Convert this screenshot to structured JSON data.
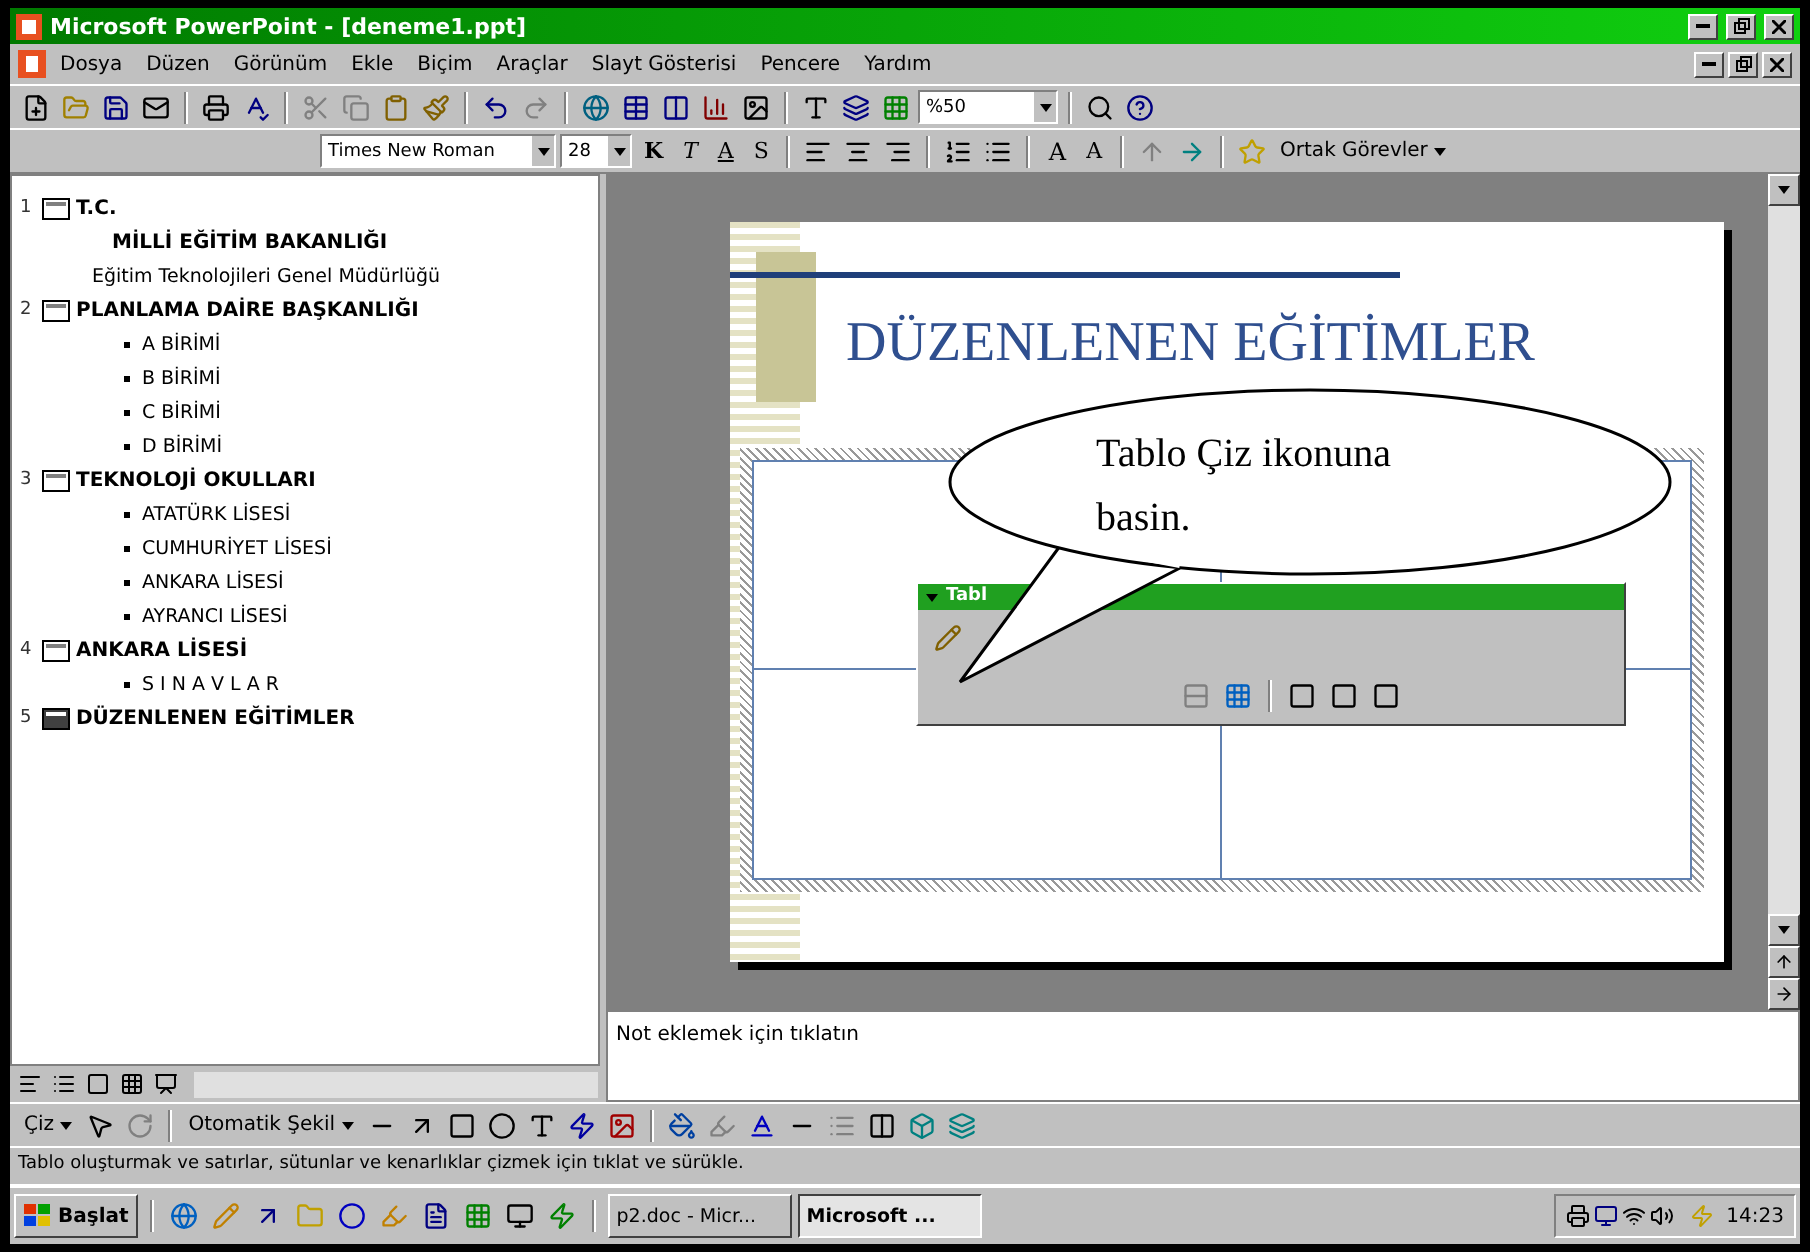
{
  "window": {
    "title": "Microsoft PowerPoint - [deneme1.ppt]"
  },
  "menu": [
    "Dosya",
    "Düzen",
    "Görünüm",
    "Ekle",
    "Biçim",
    "Araçlar",
    "Slayt Gösterisi",
    "Pencere",
    "Yardım"
  ],
  "standard_toolbar": {
    "zoom": "%50"
  },
  "formatting_toolbar": {
    "font": "Times New Roman",
    "size": "28",
    "style_buttons": [
      "K",
      "T",
      "A",
      "S"
    ],
    "font_size_buttons": [
      "A",
      "A"
    ],
    "tasks_menu": "Ortak Görevler"
  },
  "outline": [
    {
      "number": "1",
      "selected": false,
      "title": [
        "T.C.",
        "MİLLİ EĞİTİM BAKANLIĞI"
      ],
      "children": [
        {
          "kind": "plain",
          "text": "Eğitim Teknolojileri Genel Müdürlüğü"
        }
      ]
    },
    {
      "number": "2",
      "selected": false,
      "title": [
        "PLANLAMA DAİRE BAŞKANLIĞI"
      ],
      "children": [
        {
          "kind": "bullet",
          "text": "A BİRİMİ"
        },
        {
          "kind": "bullet",
          "text": "B BİRİMİ"
        },
        {
          "kind": "bullet",
          "text": "C BİRİMİ"
        },
        {
          "kind": "bullet",
          "text": "D BİRİMİ"
        }
      ]
    },
    {
      "number": "3",
      "selected": false,
      "title": [
        "TEKNOLOJİ OKULLARI"
      ],
      "children": [
        {
          "kind": "bullet",
          "text": "ATATÜRK LİSESİ"
        },
        {
          "kind": "bullet",
          "text": "CUMHURİYET LİSESİ"
        },
        {
          "kind": "bullet",
          "text": "ANKARA LİSESİ"
        },
        {
          "kind": "bullet",
          "text": "AYRANCI LİSESİ"
        }
      ]
    },
    {
      "number": "4",
      "selected": false,
      "title": [
        "ANKARA  LİSESİ"
      ],
      "children": [
        {
          "kind": "bullet",
          "text": "S I N A V L A R"
        }
      ]
    },
    {
      "number": "5",
      "selected": true,
      "title": [
        "DÜZENLENEN EĞİTİMLER"
      ]
    }
  ],
  "slide": {
    "title": "DÜZENLENEN EĞİTİMLER",
    "floating_toolbar": {
      "title": "Tabl"
    },
    "callout": "Tablo Çiz ikonuna basin."
  },
  "notes": {
    "placeholder": "Not eklemek için tıklatın"
  },
  "drawing_toolbar": {
    "draw_menu": "Çiz",
    "autoshape_menu": "Otomatik Şekil"
  },
  "status_bar": "Tablo oluşturmak ve satırlar, sütunlar ve kenarlıklar çizmek için tıklat ve sürükle.",
  "taskbar": {
    "start": "Başlat",
    "tasks": [
      {
        "label": "p2.doc - Micr...",
        "selected": false
      },
      {
        "label": "Microsoft ...",
        "selected": true
      }
    ],
    "clock": "14:23"
  }
}
